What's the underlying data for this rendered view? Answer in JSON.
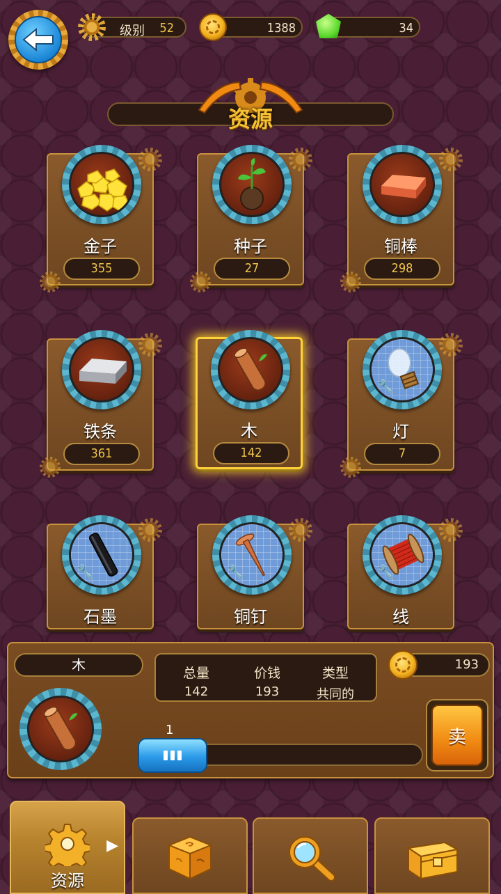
{
  "header": {
    "back_label": "back",
    "level_label": "级别",
    "level_value": "52",
    "coins": "1388",
    "gems": "34"
  },
  "title": "资源",
  "resources": [
    {
      "name": "金子",
      "count": "355",
      "icon": "gold-nuggets-icon"
    },
    {
      "name": "种子",
      "count": "27",
      "icon": "seed-icon"
    },
    {
      "name": "铜棒",
      "count": "298",
      "icon": "copper-bar-icon"
    },
    {
      "name": "铁条",
      "count": "361",
      "icon": "iron-bar-icon"
    },
    {
      "name": "木",
      "count": "142",
      "icon": "wood-log-icon",
      "selected": true
    },
    {
      "name": "灯",
      "count": "7",
      "icon": "lamp-bulb-icon"
    },
    {
      "name": "石墨",
      "count": "",
      "icon": "graphite-rod-icon"
    },
    {
      "name": "铜钉",
      "count": "",
      "icon": "copper-nail-icon"
    },
    {
      "name": "线",
      "count": "",
      "icon": "wire-spool-icon"
    }
  ],
  "detail": {
    "name": "木",
    "total_label": "总量",
    "total_value": "142",
    "price_label": "价钱",
    "price_value": "193",
    "type_label": "类型",
    "type_value": "共同的",
    "sell_price": "193",
    "quantity": "1",
    "sell_label": "卖"
  },
  "nav": {
    "resources_label": "资源",
    "items": [
      "resources-icon",
      "crafting-cube-icon",
      "search-icon",
      "chest-icon"
    ]
  },
  "colors": {
    "background": "#4a1f35",
    "card": "#7a4c22",
    "gold_text": "#f7c232",
    "highlight": "#ffd23a",
    "slider_blue": "#1f8ee0",
    "sell_orange": "#f08a12"
  }
}
